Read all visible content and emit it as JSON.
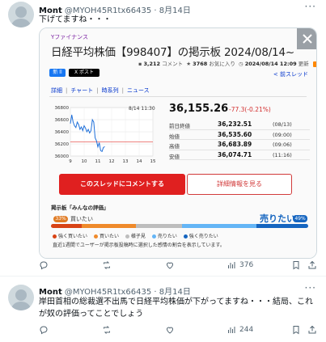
{
  "posts": [
    {
      "name": "Mont",
      "handle": "@MYOH45R1tx66435",
      "dot": "·",
      "date": "8月14日",
      "text": "下げてますね・・・",
      "more": "···",
      "views": "376",
      "card": {
        "brand": "Yファイナンス",
        "title": "日経平均株価【998407】の掲示板 2024/08/14~",
        "comments_count": "3,212",
        "comments_label": "コメント",
        "likes_count": "3768",
        "likes_label": "お気に入り",
        "updated": "2024/08/14 12:09",
        "updated_label": "更新",
        "share_new": "新 ll",
        "share_post": "X ポスト",
        "old_thread": "< 前スレッド",
        "tabs": [
          "詳細",
          "チャート",
          "時系列",
          "ニュース"
        ],
        "chart_time": "8/14 11:30",
        "price": "36,155.26",
        "change": "-77.3(-0.21%)",
        "stats": [
          {
            "label": "前日終値",
            "value": "36,232.51",
            "time": "(08/13)"
          },
          {
            "label": "始値",
            "value": "36,535.60",
            "time": "(09:00)"
          },
          {
            "label": "高値",
            "value": "36,683.89",
            "time": "(09:06)"
          },
          {
            "label": "安値",
            "value": "36,074.71",
            "time": "(11:16)"
          }
        ],
        "comment_button": "このスレッドにコメントする",
        "detail_button": "詳細情報を見る",
        "eval_label": "掲示板「みんなの評価」",
        "buy_pct": "33%",
        "buy_label": "買いたい",
        "sell_label": "売りたい",
        "sell_pct": "49%",
        "legend": [
          "強く買いたい",
          "買いたい",
          "様子見",
          "売りたい",
          "強く売りたい"
        ],
        "footnote": "直近1週間でユーザーが掲示板投稿時に選択した感情の割合を表示しています。"
      },
      "chart_data": {
        "type": "line",
        "x_ticks": [
          "9",
          "10",
          "11",
          "12",
          "13",
          "14",
          "15"
        ],
        "y_ticks": [
          "36800",
          "36600",
          "36400",
          "36200",
          "36000"
        ],
        "ylim": [
          36000,
          36800
        ],
        "xlim": [
          9,
          15
        ],
        "reference_line": 36232.51,
        "x": [
          9.0,
          9.1,
          9.2,
          9.3,
          9.4,
          9.5,
          9.6,
          9.7,
          9.8,
          9.9,
          10.0,
          10.1,
          10.2,
          10.3,
          10.4,
          10.5,
          10.6,
          10.7,
          10.8,
          10.9,
          11.0,
          11.1,
          11.2,
          11.3,
          11.4,
          11.5
        ],
        "y": [
          36535,
          36680,
          36560,
          36500,
          36470,
          36560,
          36520,
          36440,
          36480,
          36420,
          36500,
          36460,
          36400,
          36440,
          36380,
          36420,
          36600,
          36560,
          36300,
          36250,
          36150,
          36220,
          36090,
          36075,
          36140,
          36155
        ]
      }
    },
    {
      "name": "Mont",
      "handle": "@MYOH45R1tx66435",
      "dot": "·",
      "date": "8月14日",
      "text": "岸田首相の総裁選不出馬で日経平均株価が下がってますね・・・結局、これが奴の評価ってことでしょう",
      "more": "···",
      "views": "244"
    }
  ],
  "colors": {
    "strong_buy": "#d84315",
    "buy": "#ef8a2b",
    "neutral": "#bdbdbd",
    "sell": "#64b5f6",
    "strong_sell": "#1565c0"
  },
  "eval_distribution": [
    0.12,
    0.21,
    0.18,
    0.29,
    0.2
  ],
  "icons": [
    "reply-icon",
    "repost-icon",
    "like-icon",
    "views-icon",
    "bookmark-icon",
    "share-icon"
  ]
}
